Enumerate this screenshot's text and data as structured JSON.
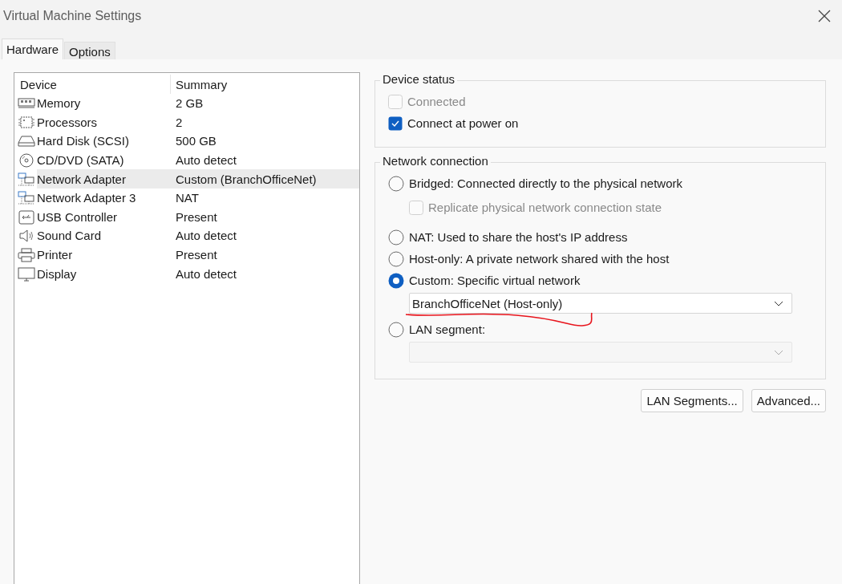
{
  "window": {
    "title": "Virtual Machine Settings"
  },
  "tabs": [
    {
      "label": "Hardware",
      "selected": true
    },
    {
      "label": "Options",
      "selected": false
    }
  ],
  "device_list": {
    "columns": [
      "Device",
      "Summary"
    ],
    "rows": [
      {
        "kind": "memory",
        "device": "Memory",
        "summary": "2 GB",
        "selected": false
      },
      {
        "kind": "processor",
        "device": "Processors",
        "summary": "2",
        "selected": false
      },
      {
        "kind": "disk",
        "device": "Hard Disk (SCSI)",
        "summary": "500 GB",
        "selected": false
      },
      {
        "kind": "cd",
        "device": "CD/DVD (SATA)",
        "summary": "Auto detect",
        "selected": false
      },
      {
        "kind": "network",
        "device": "Network Adapter",
        "summary": "Custom (BranchOfficeNet)",
        "selected": true
      },
      {
        "kind": "network",
        "device": "Network Adapter 3",
        "summary": "NAT",
        "selected": false
      },
      {
        "kind": "usb",
        "device": "USB Controller",
        "summary": "Present",
        "selected": false
      },
      {
        "kind": "sound",
        "device": "Sound Card",
        "summary": "Auto detect",
        "selected": false
      },
      {
        "kind": "printer",
        "device": "Printer",
        "summary": "Present",
        "selected": false
      },
      {
        "kind": "display",
        "device": "Display",
        "summary": "Auto detect",
        "selected": false
      }
    ]
  },
  "device_status": {
    "title": "Device status",
    "items": [
      {
        "kind": "checkbox",
        "label": "Connected",
        "checked": false,
        "disabled": true
      },
      {
        "kind": "checkbox",
        "label": "Connect at power on",
        "checked": true,
        "disabled": false
      }
    ]
  },
  "network_connection": {
    "title": "Network connection",
    "items": [
      {
        "kind": "radio",
        "label": "Bridged: Connected directly to the physical network",
        "selected": false
      },
      {
        "kind": "checkbox",
        "label": "Replicate physical network connection state",
        "checked": false,
        "disabled": true
      },
      {
        "kind": "radio",
        "label": "NAT: Used to share the host's IP address",
        "selected": false
      },
      {
        "kind": "radio",
        "label": "Host-only: A private network shared with the host",
        "selected": false
      },
      {
        "kind": "radio",
        "label": "Custom: Specific virtual network",
        "selected": true
      },
      {
        "kind": "dropdown",
        "value": "BranchOfficeNet (Host-only)",
        "disabled": false,
        "annotated": true
      },
      {
        "kind": "radio",
        "label": "LAN segment:",
        "selected": false
      },
      {
        "kind": "dropdown",
        "disabled": true,
        "annotated": false
      }
    ]
  },
  "buttons": [
    "LAN Segments...",
    "Advanced..."
  ]
}
